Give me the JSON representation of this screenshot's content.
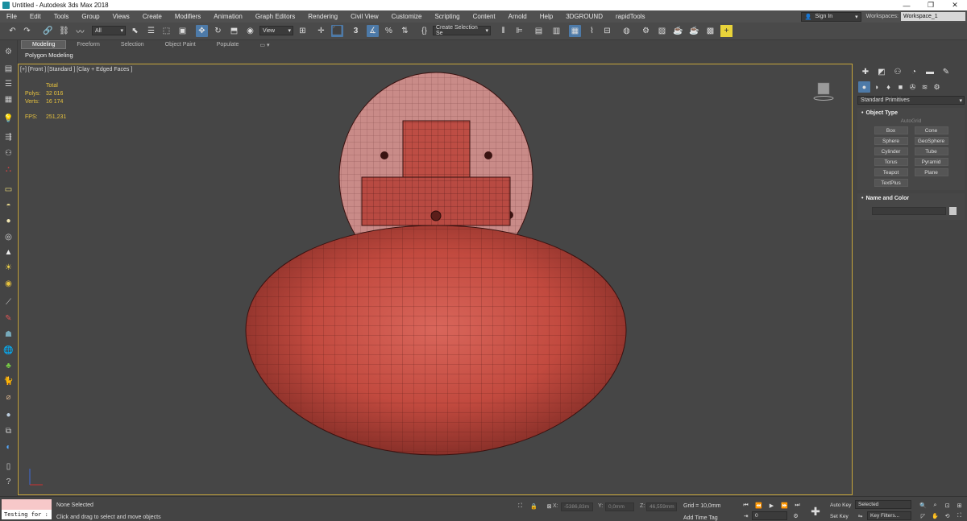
{
  "window": {
    "title": "Untitled - Autodesk 3ds Max 2018",
    "minimize": "—",
    "restore": "❐",
    "close": "✕"
  },
  "menu": {
    "items": [
      "File",
      "Edit",
      "Tools",
      "Group",
      "Views",
      "Create",
      "Modifiers",
      "Animation",
      "Graph Editors",
      "Rendering",
      "Civil View",
      "Customize",
      "Scripting",
      "Content",
      "Arnold",
      "Help",
      "3DGROUND",
      "rapidTools"
    ],
    "sign_in": "Sign In",
    "workspaces_label": "Workspaces:",
    "workspace_value": "Workspace_1"
  },
  "toolbar": {
    "filter_value": "All",
    "ref_coord_value": "View",
    "selection_set_value": "Create Selection Se",
    "snap_number": "3",
    "icons": [
      "undo-icon",
      "redo-icon",
      "link-icon",
      "unlink-icon",
      "bind-space-warp-icon",
      "select-object-icon",
      "select-by-name-icon",
      "rect-select-icon",
      "window-crossing-icon",
      "select-move-icon",
      "rotate-icon",
      "scale-icon",
      "placement-icon",
      "mirror-icon",
      "align-icon",
      "snap-toggle-icon",
      "angle-snap-icon",
      "percent-snap-icon",
      "spinner-snap-icon",
      "edit-named-sets-icon",
      "layer-explorer-icon",
      "scene-explorer-icon",
      "toggle-ribbon-icon",
      "curve-editor-icon",
      "schematic-view-icon",
      "material-editor-icon",
      "render-setup-icon",
      "rendered-frame-icon",
      "render-icon",
      "render-production-icon",
      "a360-icon"
    ]
  },
  "ribbon": {
    "tabs": [
      "Modeling",
      "Freeform",
      "Selection",
      "Object Paint",
      "Populate"
    ],
    "active_tab": "Modeling",
    "sub_label": "Polygon Modeling"
  },
  "viewport": {
    "label": "[+] [Front ] [Standard ] [Clay + Edged Faces ]",
    "stats_header": "Total",
    "polys_label": "Polys:",
    "polys_value": "32 016",
    "verts_label": "Verts:",
    "verts_value": "16 174",
    "fps_label": "FPS:",
    "fps_value": "251,231",
    "object_color": "#c8483f",
    "border_color": "#c7a63c"
  },
  "command_panel": {
    "category_value": "Standard Primitives",
    "object_type_title": "Object Type",
    "autogrid_label": "AutoGrid",
    "primitives": [
      "Box",
      "Cone",
      "Sphere",
      "GeoSphere",
      "Cylinder",
      "Tube",
      "Torus",
      "Pyramid",
      "Teapot",
      "Plane",
      "TextPlus"
    ],
    "name_color_title": "Name and Color"
  },
  "status": {
    "maxscript_text": "Testing for :",
    "selection_status": "None Selected",
    "prompt": "Click and drag to select and move objects",
    "x_label": "X:",
    "x_value": "-5386,83m",
    "y_label": "Y:",
    "y_value": "0,0mm",
    "z_label": "Z:",
    "z_value": "46,559mm",
    "grid": "Grid = 10,0mm",
    "add_time_tag": "Add Time Tag",
    "frame_value": "0",
    "auto_key": "Auto Key",
    "set_key": "Set Key",
    "selected_value": "Selected",
    "key_filters": "Key Filters..."
  }
}
